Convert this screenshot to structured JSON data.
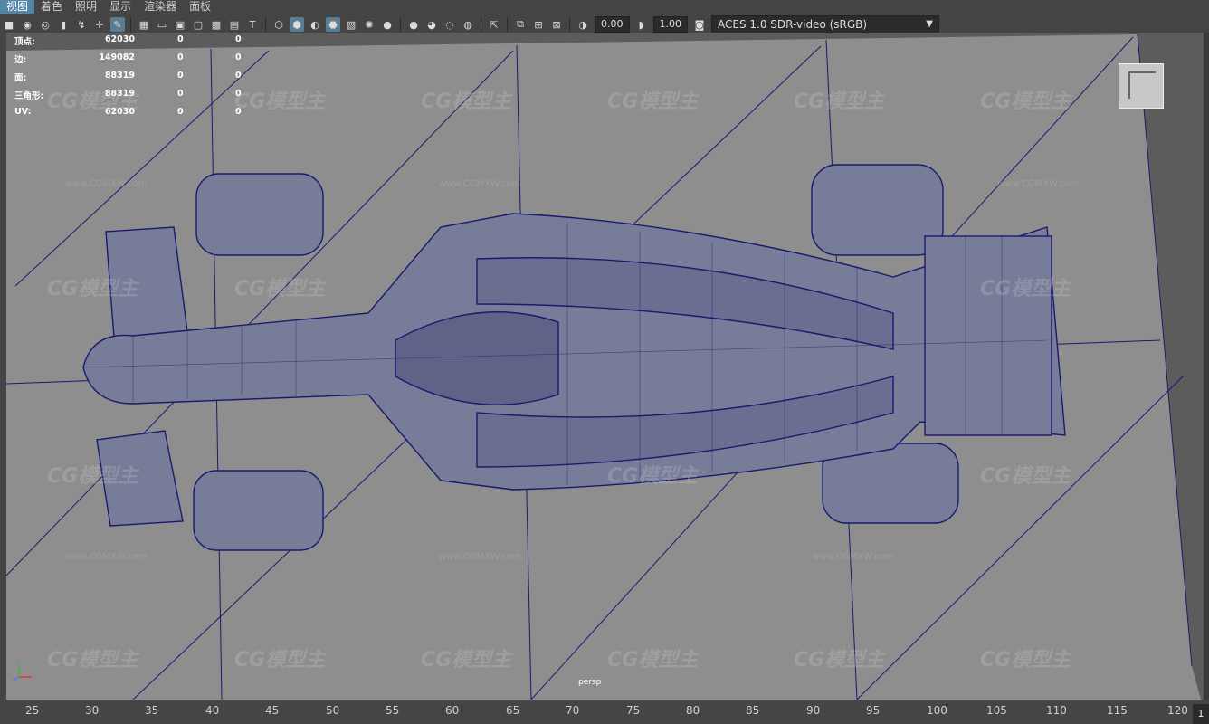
{
  "menu": {
    "items": [
      {
        "label": "视图",
        "active": true
      },
      {
        "label": "着色",
        "active": false
      },
      {
        "label": "照明",
        "active": false
      },
      {
        "label": "显示",
        "active": false
      },
      {
        "label": "渲染器",
        "active": false
      },
      {
        "label": "面板",
        "active": false
      }
    ]
  },
  "toolbar": {
    "exposure_value": "0.00",
    "gamma_value": "1.00",
    "color_space": "ACES 1.0 SDR-video (sRGB)",
    "icons": [
      "camera-icon",
      "camera-lock-icon",
      "bookmark-icon",
      "image-plane-icon",
      "grid-icon",
      "film-gate-icon",
      "resolution-gate-icon",
      "safe-action-icon",
      "wireframe-icon",
      "smooth-shade-icon",
      "textured-icon",
      "xray-icon",
      "light-icon",
      "shadow-icon",
      "isolate-icon",
      "exposure-icon",
      "gamma-icon",
      "color-management-icon"
    ]
  },
  "hud": {
    "rows": [
      {
        "label": "顶点:",
        "v1": "62030",
        "v2": "0",
        "v3": "0"
      },
      {
        "label": "边:",
        "v1": "149082",
        "v2": "0",
        "v3": "0"
      },
      {
        "label": "面:",
        "v1": "88319",
        "v2": "0",
        "v3": "0"
      },
      {
        "label": "三角形:",
        "v1": "88319",
        "v2": "0",
        "v3": "0"
      },
      {
        "label": "UV:",
        "v1": "62030",
        "v2": "0",
        "v3": "0"
      }
    ]
  },
  "viewport": {
    "camera": "persp",
    "watermark_brand": "CG模型主",
    "watermark_url": "www.CGMXW.com",
    "wire_color": "#1a1a6e",
    "background": "#5c5c5c"
  },
  "timeline": {
    "ticks": [
      "25",
      "30",
      "35",
      "40",
      "45",
      "50",
      "55",
      "60",
      "65",
      "70",
      "75",
      "80",
      "85",
      "90",
      "95",
      "100",
      "105",
      "110",
      "115",
      "120"
    ],
    "current_frame": "1"
  }
}
